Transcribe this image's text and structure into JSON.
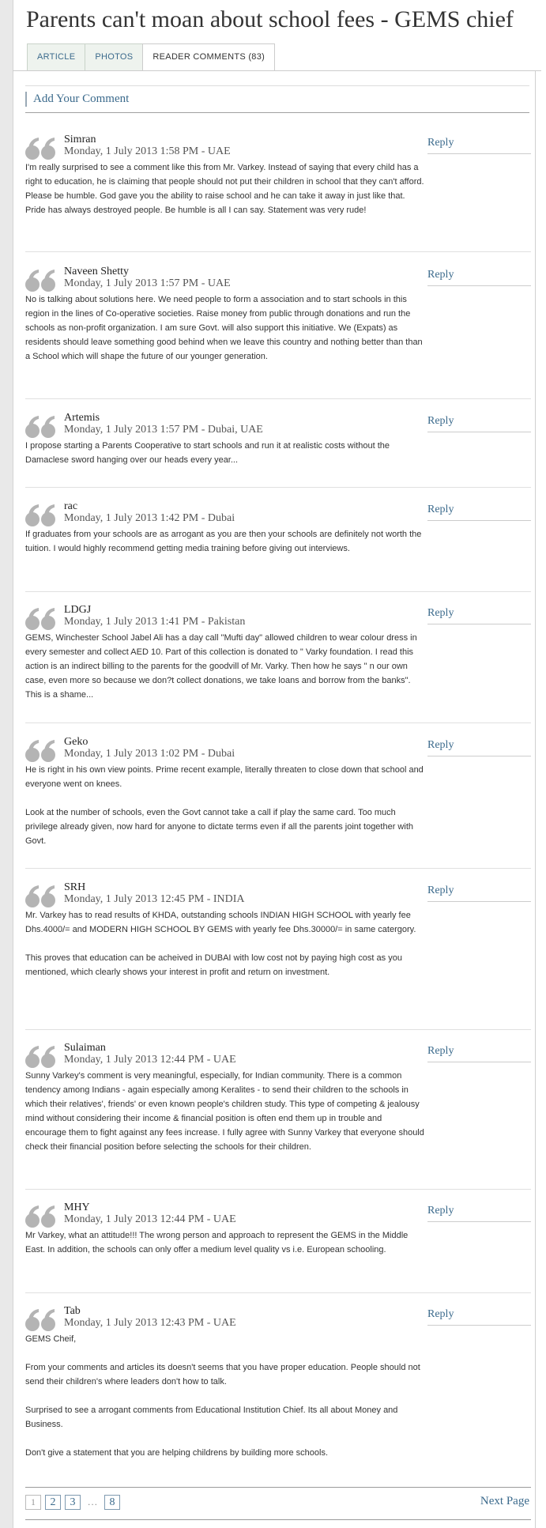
{
  "article": {
    "title": "Parents can't moan about school fees - GEMS chief"
  },
  "tabs": [
    {
      "label": "ARTICLE",
      "active": false
    },
    {
      "label": "PHOTOS",
      "active": false
    },
    {
      "label": "READER COMMENTS (83)",
      "active": true
    }
  ],
  "add_comment_label": "Add Your Comment",
  "reply_label": "Reply",
  "quote_icon": "double-quote-mark",
  "colors": {
    "link": "#3b6a8c",
    "quote_icon": "#b4b4b4",
    "tab_background": "#eef3ee"
  },
  "comments": [
    {
      "author": "Simran",
      "date": "Monday, 1 July 2013 1:58 PM - UAE",
      "paragraphs": [
        "I'm really surprised to see a comment like this from Mr. Varkey. Instead of saying that every child has a right to education, he is claiming that people should not put their children in school that they can't afford. Please be humble. God gave you the ability to raise school and he can take it away in just like that. Pride has always destroyed people. Be humble is all I can say. Statement was very rude!"
      ]
    },
    {
      "author": "Naveen Shetty",
      "date": "Monday, 1 July 2013 1:57 PM - UAE",
      "paragraphs": [
        "No is talking about solutions here. We need people to form a association and to start schools in this region in the lines of Co-operative societies. Raise money from public through donations and run the schools as non-profit organization. I am sure Govt. will also support this initiative. We (Expats) as residents should leave something good behind when we leave this country and nothing better than than a School which will shape the future of our younger generation."
      ]
    },
    {
      "author": "Artemis",
      "date": "Monday, 1 July 2013 1:57 PM - Dubai, UAE",
      "paragraphs": [
        "I propose starting a Parents Cooperative to start schools and run it at realistic costs without the Damaclese sword hanging over our heads every year..."
      ]
    },
    {
      "author": "rac",
      "date": "Monday, 1 July 2013 1:42 PM - Dubai",
      "paragraphs": [
        "If graduates from your schools are as arrogant as you are then your schools are definitely not worth the tuition. I would highly recommend getting media training before giving out interviews."
      ]
    },
    {
      "author": "LDGJ",
      "date": "Monday, 1 July 2013 1:41 PM - Pakistan",
      "paragraphs": [
        "GEMS, Winchester School Jabel Ali has a day call \"Mufti day\" allowed children to wear colour dress in every semester and collect AED 10. Part of this collection is donated to \" Varky foundation. I read this action is an indirect billing to the parents for the goodvill of Mr. Varky. Then how he says \" n our own case, even more so because we don?t collect donations, we take loans and borrow from the banks\". This is a shame..."
      ]
    },
    {
      "author": "Geko",
      "date": "Monday, 1 July 2013 1:02 PM - Dubai",
      "paragraphs": [
        "He is right in his own view points. Prime recent example, literally threaten to close down that school and everyone went on knees.",
        "Look at the number of schools, even the Govt cannot take a call if play the same card. Too much privilege already given, now hard for anyone to dictate terms even if all the parents joint together with Govt."
      ]
    },
    {
      "author": "SRH",
      "date": "Monday, 1 July 2013 12:45 PM - INDIA",
      "paragraphs": [
        "Mr. Varkey has to read results of KHDA, outstanding schools INDIAN HIGH SCHOOL with yearly fee Dhs.4000/= and MODERN HIGH SCHOOL BY GEMS with yearly fee Dhs.30000/= in same catergory.",
        "This proves that education can be acheived in DUBAI with low cost not by paying high cost as you mentioned, which clearly shows your interest in profit and return on investment."
      ]
    },
    {
      "author": "Sulaiman",
      "date": "Monday, 1 July 2013 12:44 PM - UAE",
      "paragraphs": [
        "Sunny Varkey's comment is very meaningful, especially, for Indian community. There is a common tendency among Indians - again especially among Keralites - to send their children to the schools in which their relatives', friends' or even known people's children study. This type of competing & jealousy mind without considering their income & financial position is often end them up in trouble and encourage them to fight against any fees increase. I fully agree with Sunny Varkey that everyone should check their financial position before selecting the schools for their children."
      ]
    },
    {
      "author": "MHY",
      "date": "Monday, 1 July 2013 12:44 PM - UAE",
      "paragraphs": [
        "Mr Varkey, what an attitude!!! The wrong person and approach to represent the GEMS in the Middle East. In addition, the schools can only offer a medium level quality vs i.e. European schooling."
      ]
    },
    {
      "author": "Tab",
      "date": "Monday, 1 July 2013 12:43 PM - UAE",
      "paragraphs": [
        "GEMS Cheif,",
        "From your comments and articles its doesn't seems that you have proper education. People should not send their children's where leaders don't how to talk.",
        "Surprised to see a arrogant comments from Educational Institution Chief. Its all about Money and Business.",
        "Don't give a statement that you are helping childrens by building more schools."
      ]
    }
  ],
  "pagination": {
    "current": "1",
    "pages": [
      "2",
      "3"
    ],
    "ellipsis": "...",
    "last": "8",
    "next_label": "Next Page"
  }
}
